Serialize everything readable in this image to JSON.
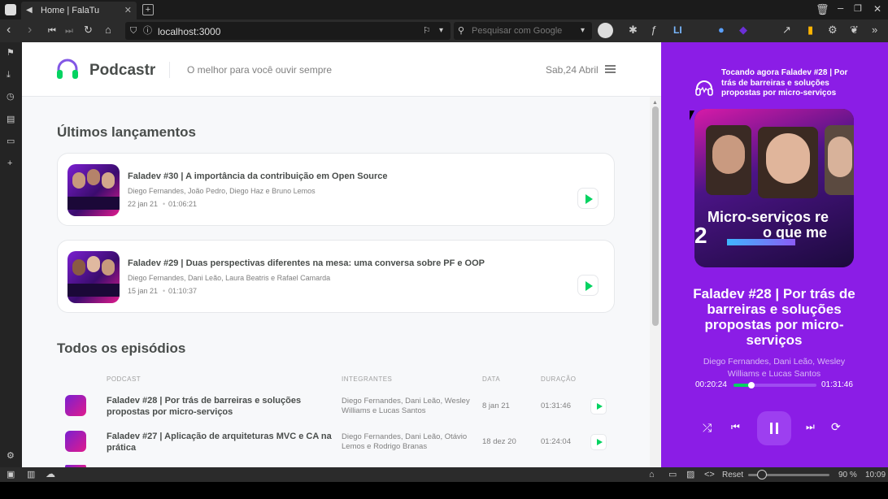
{
  "browser": {
    "tab_title": "Home | FalaTu",
    "url": "localhost:3000",
    "search_placeholder": "Pesquisar com Google",
    "status": {
      "reset_label": "Reset",
      "zoom": "90 %",
      "clock": "10:09"
    }
  },
  "header": {
    "logo": "Podcastr",
    "tagline": "O melhor para você ouvir sempre",
    "date": "Sab,24 Abril"
  },
  "latest": {
    "title": "Últimos lançamentos",
    "items": [
      {
        "title": "Faladev #30 | A importância da contribuição em Open Source",
        "members": "Diego Fernandes, João Pedro, Diego Haz e Bruno Lemos",
        "date": "22 jan 21",
        "duration": "01:06:21"
      },
      {
        "title": "Faladev #29 | Duas perspectivas diferentes na mesa: uma conversa sobre PF e OOP",
        "members": "Diego Fernandes, Dani Leão, Laura Beatris e Rafael Camarda",
        "date": "15 jan 21",
        "duration": "01:10:37"
      }
    ]
  },
  "all": {
    "title": "Todos os episódios",
    "columns": [
      "PODCAST",
      "INTEGRANTES",
      "DATA",
      "DURAÇÃO"
    ],
    "rows": [
      {
        "title": "Faladev #28 | Por trás de barreiras e soluções propostas por micro-serviços",
        "members": "Diego Fernandes, Dani Leão, Wesley Williams e Lucas Santos",
        "date": "8 jan 21",
        "duration": "01:31:46"
      },
      {
        "title": "Faladev #27 | Aplicação de arquiteturas MVC e CA na prática",
        "members": "Diego Fernandes, Dani Leão, Otávio Lemos e Rodrigo Branas",
        "date": "18 dez 20",
        "duration": "01:24:04"
      }
    ]
  },
  "player": {
    "now_playing": "Tocando agora Faladev #28 | Por trás de barreiras e soluções propostas por micro-serviços",
    "cover_text_1": "Micro-serviços re",
    "cover_text_2": "o que me",
    "cover_number": "2",
    "title": "Faladev #28 | Por trás de barreiras e soluções propostas por micro-serviços",
    "members": "Diego Fernandes, Dani Leão, Wesley Williams e Lucas Santos",
    "current_time": "00:20:24",
    "duration": "01:31:46",
    "progress": 0.22
  },
  "colors": {
    "player_bg": "#8b1de6",
    "accent_green": "#04d361",
    "text_dark": "#494d4b"
  }
}
